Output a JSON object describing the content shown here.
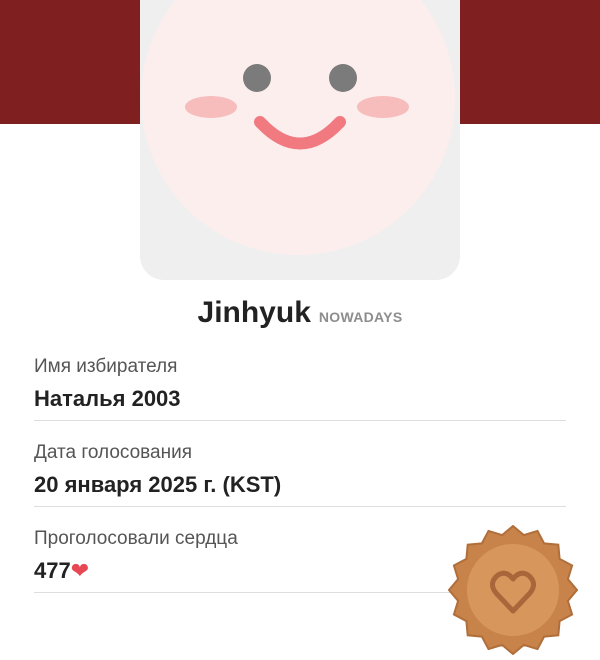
{
  "profile": {
    "name": "Jinhyuk",
    "group": "NOWADAYS",
    "avatar_icon": "smiling-face-avatar"
  },
  "fields": [
    {
      "label": "Имя избирателя",
      "value": "Наталья 2003"
    },
    {
      "label": "Дата голосования",
      "value": "20 января 2025 г. (KST)"
    },
    {
      "label": "Проголосовали сердца",
      "value": "477"
    }
  ],
  "colors": {
    "header": "#801f20",
    "heart": "#e84855",
    "badge": "#c8834a"
  },
  "badge_icon": "heart-seal-badge-icon"
}
